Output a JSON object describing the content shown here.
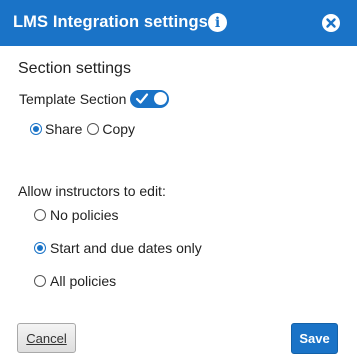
{
  "header": {
    "title": "LMS Integration settings",
    "info_icon": "info-icon",
    "info_glyph": "i",
    "close_icon": "close-icon"
  },
  "section": {
    "title": "Section settings",
    "template_label": "Template Section",
    "template_toggle_on": true,
    "share_options": [
      {
        "label": "Share",
        "selected": true
      },
      {
        "label": "Copy",
        "selected": false
      }
    ]
  },
  "instructors": {
    "label": "Allow instructors to edit:",
    "options": [
      {
        "label": "No policies",
        "selected": false
      },
      {
        "label": "Start and due dates only",
        "selected": true
      },
      {
        "label": "All policies",
        "selected": false
      }
    ]
  },
  "footer": {
    "cancel_label": "Cancel",
    "save_label": "Save"
  },
  "colors": {
    "accent": "#1a73c7",
    "header_bg": "#1a73c7"
  }
}
